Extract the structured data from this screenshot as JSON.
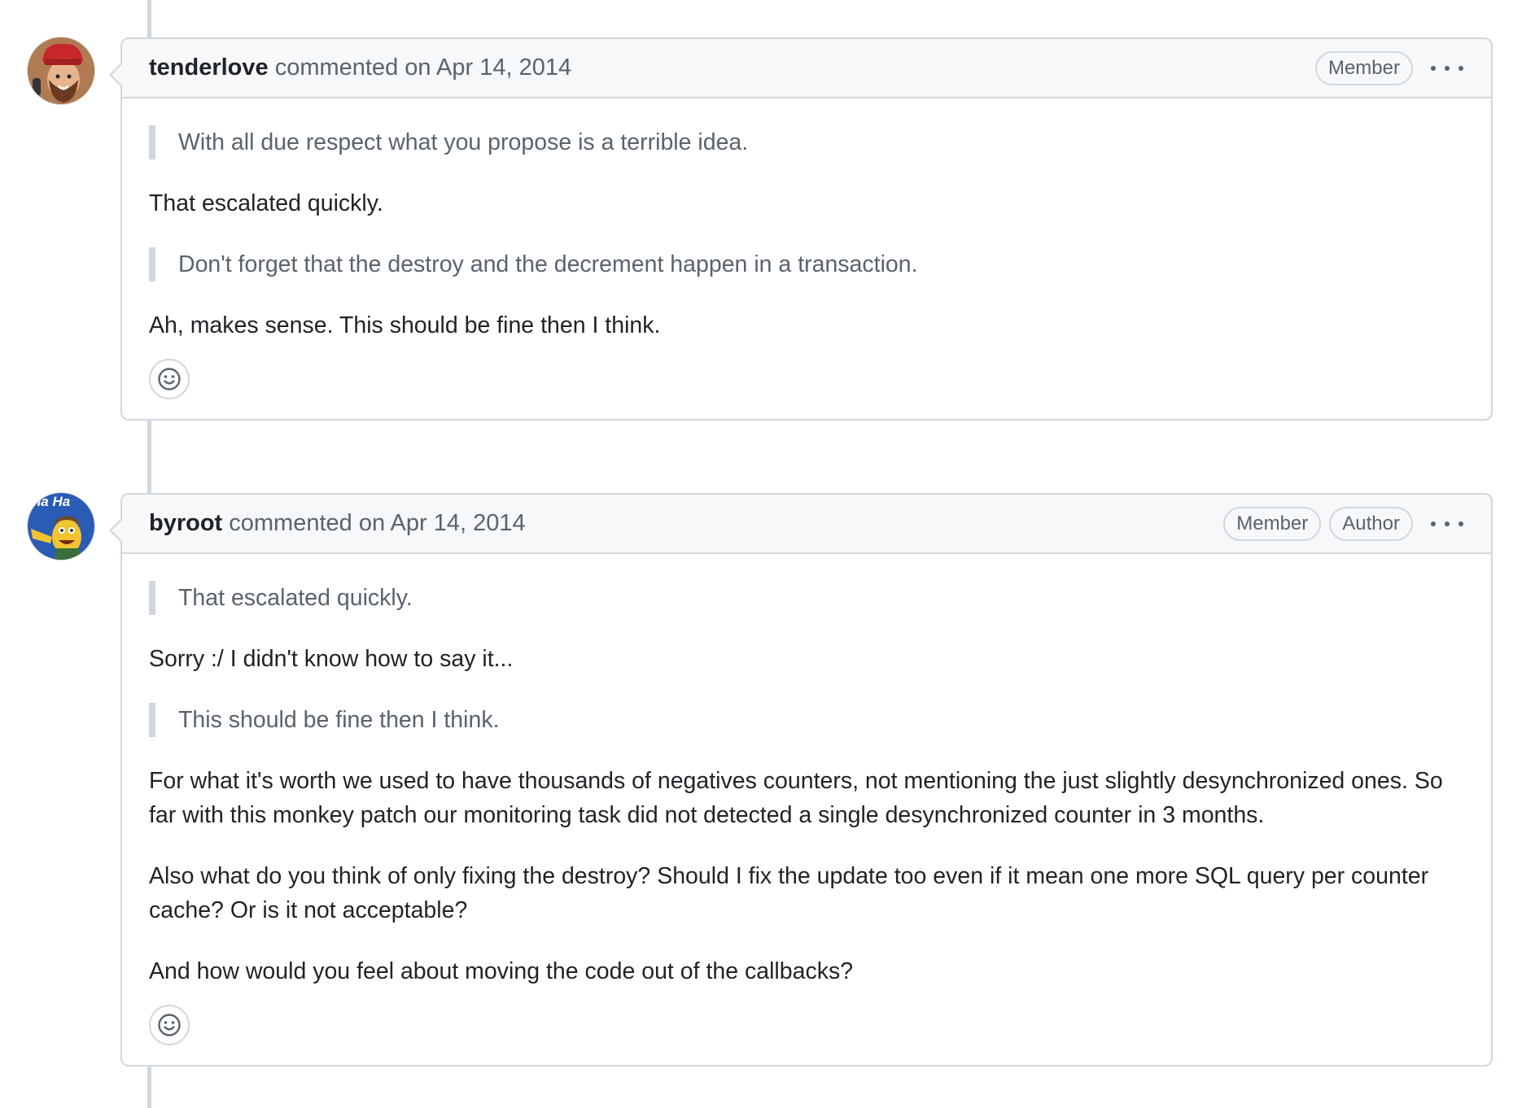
{
  "comments": [
    {
      "author": "tenderlove",
      "action": " commented on Apr 14, 2014",
      "badges": [
        "Member"
      ],
      "avatar_icon": "avatar-chef-hat",
      "body": [
        {
          "type": "quote",
          "text": "With all due respect what you propose is a terrible idea."
        },
        {
          "type": "para",
          "text": "That escalated quickly."
        },
        {
          "type": "quote",
          "text": "Don't forget that the destroy and the decrement happen in a transaction."
        },
        {
          "type": "para",
          "text": "Ah, makes sense. This should be fine then I think."
        }
      ],
      "reaction_icon": "smiley-icon"
    },
    {
      "author": "byroot",
      "action": " commented on Apr 14, 2014",
      "badges": [
        "Member",
        "Author"
      ],
      "avatar_icon": "avatar-cartoon-ha-ha",
      "avatar_text": "Ha Ha",
      "body": [
        {
          "type": "quote",
          "text": "That escalated quickly."
        },
        {
          "type": "para",
          "text": "Sorry :/ I didn't know how to say it..."
        },
        {
          "type": "quote",
          "text": "This should be fine then I think."
        },
        {
          "type": "para",
          "text": "For what it's worth we used to have thousands of negatives counters, not mentioning the just slightly desynchronized ones. So far with this monkey patch our monitoring task did not detected a single desynchronized counter in 3 months."
        },
        {
          "type": "para",
          "text": "Also what do you think of only fixing the destroy? Should I fix the update too even if it mean one more SQL query per counter cache? Or is it not acceptable?"
        },
        {
          "type": "para",
          "text": "And how would you feel about moving the code out of the callbacks?"
        }
      ],
      "reaction_icon": "smiley-icon"
    }
  ],
  "colors": {
    "border": "#d0d7de",
    "header_bg": "#f6f8fa",
    "muted_text": "#59636e",
    "text": "#1f2328"
  }
}
